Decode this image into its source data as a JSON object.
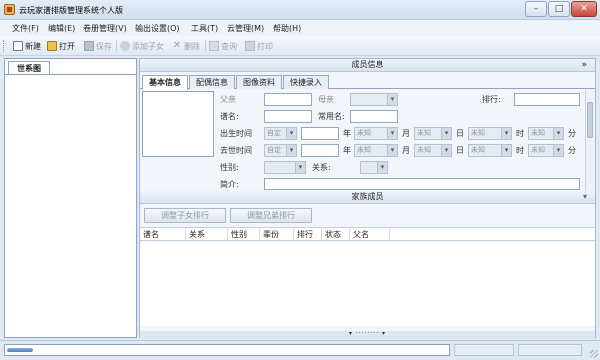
{
  "window": {
    "title": "云玩家谱排版管理系统个人版"
  },
  "menu": [
    {
      "label": "文件(F)"
    },
    {
      "label": "编辑(E)"
    },
    {
      "label": "卷册管理(V)"
    },
    {
      "label": "输出设置(O)"
    },
    {
      "label": "工具(T)"
    },
    {
      "label": "云管理(M)"
    },
    {
      "label": "帮助(H)"
    }
  ],
  "toolbar": {
    "new": "新建",
    "open": "打开",
    "save": "保存",
    "add_child": "添加子女",
    "delete": "删除",
    "query": "查询",
    "print": "打印"
  },
  "left": {
    "tab": "世系图"
  },
  "member_info": {
    "header": "成员信息",
    "collapse_arrow": "»"
  },
  "tabs": [
    {
      "label": "基本信息",
      "active": true
    },
    {
      "label": "配偶信息",
      "active": false
    },
    {
      "label": "图像资料",
      "active": false
    },
    {
      "label": "快捷录入",
      "active": false
    }
  ],
  "form": {
    "father": "父亲",
    "mother": "母亲",
    "rank": "排行:",
    "genealogy_name": "谱名:",
    "common_name": "常用名:",
    "birth_time": "出生时间",
    "death_time": "去世时间",
    "custom": "自定",
    "unknown": "未知",
    "year": "年",
    "month": "月",
    "day": "日",
    "hour": "时",
    "minute": "分",
    "gender": "性别:",
    "relation": "关系:",
    "brief": "简介:"
  },
  "family": {
    "header": "家族成员",
    "adjust_children": "调整子女排行",
    "adjust_siblings": "调整兄弟排行",
    "columns": [
      "谱名",
      "关系",
      "性别",
      "辈份",
      "排行",
      "状态",
      "父名"
    ]
  },
  "splitter_handle": "▾ ········ ▾",
  "status": {
    "progress": 0.06
  }
}
